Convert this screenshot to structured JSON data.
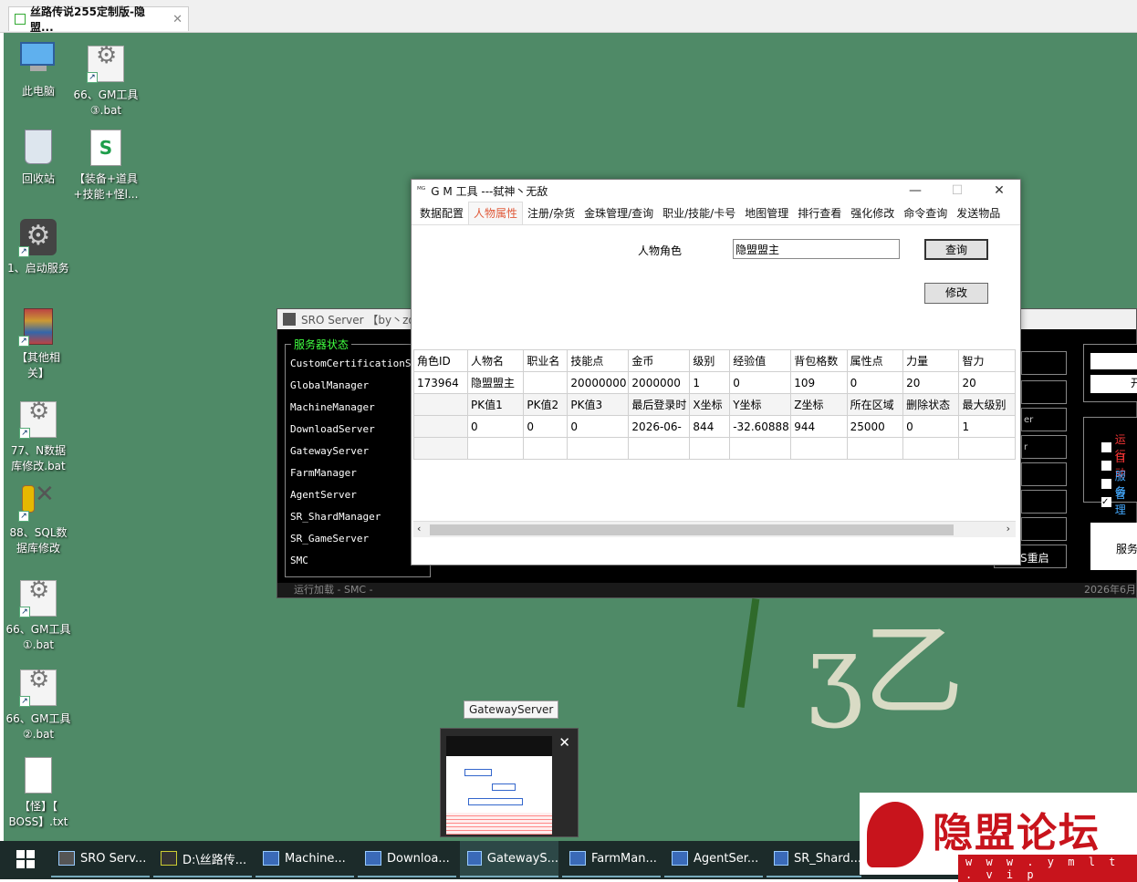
{
  "browser_tab": {
    "title": "丝路传说255定制版-隐盟..."
  },
  "desktop_icons": [
    {
      "label_1": "此电脑",
      "label_2": ""
    },
    {
      "label_1": "66、GM工具",
      "label_2": "③.bat"
    },
    {
      "label_1": "回收站",
      "label_2": ""
    },
    {
      "label_1": "【装备+道具",
      "label_2": "+技能+怪l..."
    },
    {
      "label_1": "1、启动服务",
      "label_2": ""
    },
    {
      "label_1": "【其他相",
      "label_2": "关】"
    },
    {
      "label_1": "77、N数据",
      "label_2": "库修改.bat"
    },
    {
      "label_1": "88、SQL数",
      "label_2": "据库修改"
    },
    {
      "label_1": "66、GM工具",
      "label_2": "①.bat"
    },
    {
      "label_1": "66、GM工具",
      "label_2": "②.bat"
    },
    {
      "label_1": "【怪】【",
      "label_2": "BOSS】.txt"
    }
  ],
  "sro_window": {
    "title": "SRO Server 【by丶zo",
    "group_label": "服务器状态",
    "services": [
      "CustomCertificationSer",
      "GlobalManager",
      "MachineManager",
      "DownloadServer",
      "GatewayServer",
      "FarmManager",
      "AgentServer",
      "SR_ShardManager",
      "SR_GameServer",
      "SMC"
    ],
    "status_text": "运行加载 - SMC -",
    "date_text": "2026年6月",
    "right_labels": [
      "er",
      "r",
      "S重启",
      "服务"
    ],
    "checkboxes": [
      {
        "label": "运行",
        "checked": false
      },
      {
        "label": "自动",
        "checked": false
      },
      {
        "label": "服务",
        "checked": false
      },
      {
        "label": "管理",
        "checked": true
      }
    ],
    "open_btn": "开"
  },
  "gm_window": {
    "title": "G M 工具 ---弑神丶无敌",
    "menu": [
      "数据配置",
      "人物属性",
      "注册/杂货",
      "金珠管理/查询",
      "职业/技能/卡号",
      "地图管理",
      "排行查看",
      "强化修改",
      "命令查询",
      "发送物品"
    ],
    "active_menu": "人物属性",
    "query_label": "人物角色",
    "query_value": "隐盟盟主",
    "query_button": "查询",
    "modify_button": "修改",
    "table": {
      "header1": [
        "角色ID",
        "人物名",
        "职业名",
        "技能点",
        "金币",
        "级别",
        "经验值",
        "背包格数",
        "属性点",
        "力量",
        "智力"
      ],
      "row1": [
        "173964",
        "隐盟盟主",
        "",
        "20000000",
        "2000000",
        "1",
        "0",
        "109",
        "0",
        "20",
        "20"
      ],
      "header2": [
        "",
        "PK值1",
        "PK值2",
        "PK值3",
        "最后登录时",
        "X坐标",
        "Y坐标",
        "Z坐标",
        "所在区域",
        "删除状态",
        "最大级别"
      ],
      "row2": [
        "",
        "0",
        "0",
        "0",
        "2026-06-",
        "844",
        "-32.60888",
        "944",
        "25000",
        "0",
        "1"
      ],
      "row3": [
        "",
        "",
        "",
        "",
        "",
        "",
        "",
        "",
        "",
        "",
        ""
      ]
    }
  },
  "tooltip": "GatewayServer",
  "taskbar": {
    "items": [
      "SRO Serv...",
      "D:\\丝路传...",
      "Machine...",
      "Downloa...",
      "GatewayS...",
      "FarmMan...",
      "AgentSer...",
      "SR_Shard..."
    ]
  },
  "watermark": {
    "text": "隐盟论坛",
    "url": "w w w . y m l t . v i p"
  }
}
